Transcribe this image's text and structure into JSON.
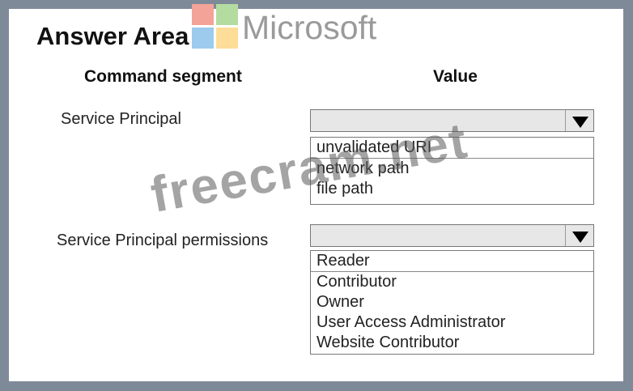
{
  "title": "Answer Area",
  "brand": {
    "name": "Microsoft",
    "logo_colors": [
      "#f3a398",
      "#b5dca0",
      "#9ccbee",
      "#fedd98"
    ]
  },
  "headers": {
    "command": "Command segment",
    "value": "Value"
  },
  "rows": [
    {
      "label": "Service Principal",
      "options": [
        "unvalidated URI",
        "network path",
        "file path"
      ]
    },
    {
      "label": "Service Principal permissions",
      "options": [
        "Reader",
        "Contributor",
        "Owner",
        "User Access Administrator",
        "Website Contributor"
      ]
    }
  ],
  "watermark": "freecram.net"
}
